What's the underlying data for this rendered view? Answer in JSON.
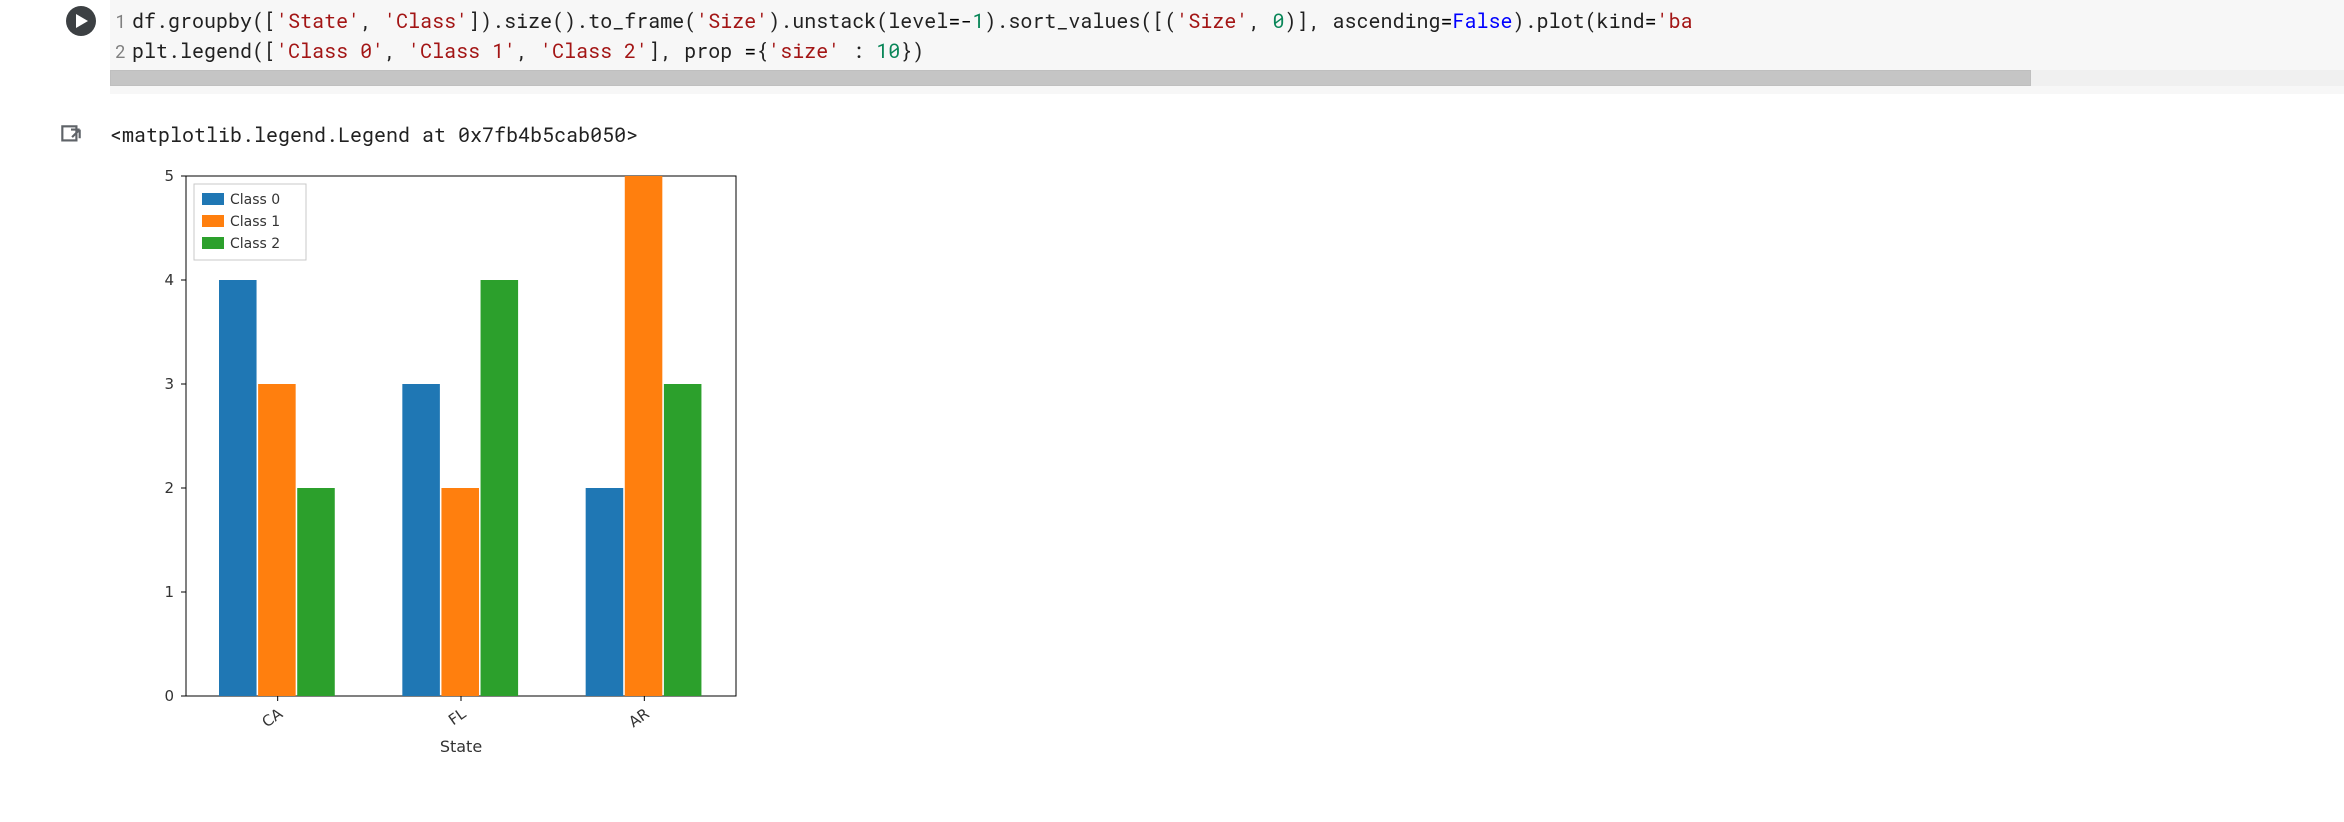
{
  "code": {
    "lines": [
      {
        "num": "1",
        "tokens": [
          {
            "t": "df",
            "c": "tok-plain"
          },
          {
            "t": ".",
            "c": "tok-op"
          },
          {
            "t": "groupby",
            "c": "tok-plain"
          },
          {
            "t": "([",
            "c": "tok-op"
          },
          {
            "t": "'State'",
            "c": "tok-str"
          },
          {
            "t": ", ",
            "c": "tok-op"
          },
          {
            "t": "'Class'",
            "c": "tok-str"
          },
          {
            "t": "])",
            "c": "tok-op"
          },
          {
            "t": ".",
            "c": "tok-op"
          },
          {
            "t": "size",
            "c": "tok-plain"
          },
          {
            "t": "()",
            "c": "tok-op"
          },
          {
            "t": ".",
            "c": "tok-op"
          },
          {
            "t": "to_frame",
            "c": "tok-plain"
          },
          {
            "t": "(",
            "c": "tok-op"
          },
          {
            "t": "'Size'",
            "c": "tok-str"
          },
          {
            "t": ")",
            "c": "tok-op"
          },
          {
            "t": ".",
            "c": "tok-op"
          },
          {
            "t": "unstack",
            "c": "tok-plain"
          },
          {
            "t": "(",
            "c": "tok-op"
          },
          {
            "t": "level",
            "c": "tok-plain"
          },
          {
            "t": "=-",
            "c": "tok-eq"
          },
          {
            "t": "1",
            "c": "tok-int"
          },
          {
            "t": ")",
            "c": "tok-op"
          },
          {
            "t": ".",
            "c": "tok-op"
          },
          {
            "t": "sort_values",
            "c": "tok-plain"
          },
          {
            "t": "([(",
            "c": "tok-op"
          },
          {
            "t": "'Size'",
            "c": "tok-str"
          },
          {
            "t": ", ",
            "c": "tok-op"
          },
          {
            "t": "0",
            "c": "tok-int"
          },
          {
            "t": ")], ",
            "c": "tok-op"
          },
          {
            "t": "ascending",
            "c": "tok-plain"
          },
          {
            "t": "=",
            "c": "tok-eq"
          },
          {
            "t": "False",
            "c": "tok-kw"
          },
          {
            "t": ")",
            "c": "tok-op"
          },
          {
            "t": ".",
            "c": "tok-op"
          },
          {
            "t": "plot",
            "c": "tok-plain"
          },
          {
            "t": "(",
            "c": "tok-op"
          },
          {
            "t": "kind",
            "c": "tok-plain"
          },
          {
            "t": "=",
            "c": "tok-eq"
          },
          {
            "t": "'ba",
            "c": "tok-str"
          }
        ]
      },
      {
        "num": "2",
        "tokens": [
          {
            "t": "plt",
            "c": "tok-plain"
          },
          {
            "t": ".",
            "c": "tok-op"
          },
          {
            "t": "legend",
            "c": "tok-plain"
          },
          {
            "t": "([",
            "c": "tok-op"
          },
          {
            "t": "'Class 0'",
            "c": "tok-str"
          },
          {
            "t": ", ",
            "c": "tok-op"
          },
          {
            "t": "'Class 1'",
            "c": "tok-str"
          },
          {
            "t": ", ",
            "c": "tok-op"
          },
          {
            "t": "'Class 2'",
            "c": "tok-str"
          },
          {
            "t": "], ",
            "c": "tok-op"
          },
          {
            "t": "prop ",
            "c": "tok-plain"
          },
          {
            "t": "=",
            "c": "tok-eq"
          },
          {
            "t": "{",
            "c": "tok-op"
          },
          {
            "t": "'size'",
            "c": "tok-str"
          },
          {
            "t": " : ",
            "c": "tok-op"
          },
          {
            "t": "10",
            "c": "tok-int"
          },
          {
            "t": "})",
            "c": "tok-op"
          }
        ]
      }
    ],
    "scroll_thumb_width_pct": 86
  },
  "output": {
    "repr": "<matplotlib.legend.Legend at 0x7fb4b5cab050>"
  },
  "chart_data": {
    "type": "bar",
    "categories": [
      "CA",
      "FL",
      "AR"
    ],
    "series": [
      {
        "name": "Class 0",
        "values": [
          4,
          3,
          2
        ],
        "color": "#1f77b4"
      },
      {
        "name": "Class 1",
        "values": [
          3,
          2,
          5
        ],
        "color": "#ff7f0e"
      },
      {
        "name": "Class 2",
        "values": [
          2,
          4,
          3
        ],
        "color": "#2ca02c"
      }
    ],
    "xlabel": "State",
    "ylabel": "",
    "ylim": [
      0,
      5
    ],
    "yticks": [
      0,
      1,
      2,
      3,
      4,
      5
    ],
    "legend_position": "upper-left"
  }
}
